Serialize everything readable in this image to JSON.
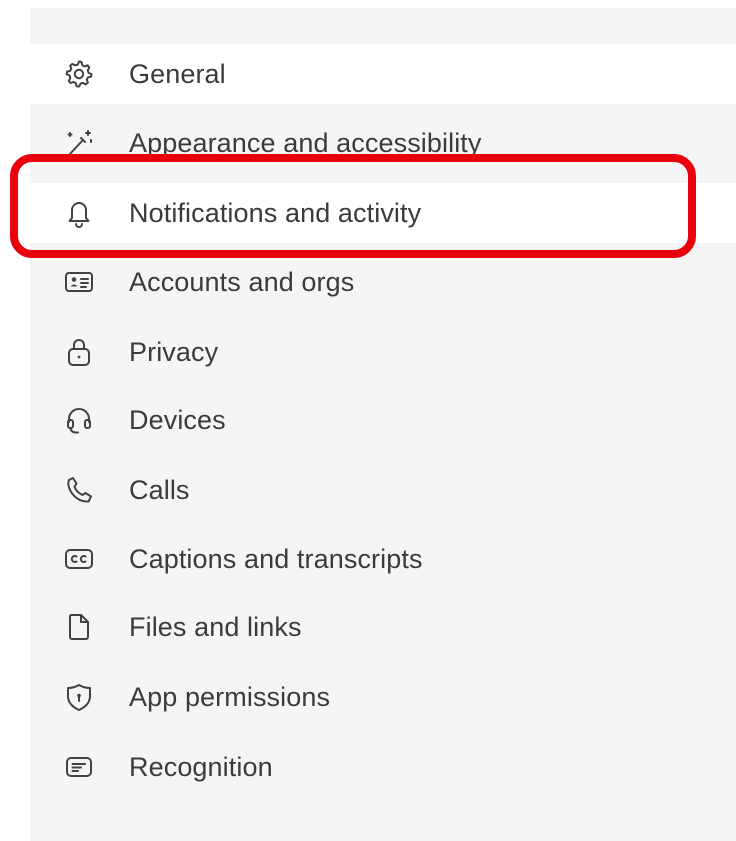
{
  "settings_menu": {
    "items": [
      {
        "label": "General",
        "icon": "gear-icon"
      },
      {
        "label": "Appearance and accessibility",
        "icon": "magic-wand-icon"
      },
      {
        "label": "Notifications and activity",
        "icon": "bell-icon"
      },
      {
        "label": "Accounts and orgs",
        "icon": "contact-card-icon"
      },
      {
        "label": "Privacy",
        "icon": "lock-icon"
      },
      {
        "label": "Devices",
        "icon": "headset-icon"
      },
      {
        "label": "Calls",
        "icon": "phone-icon"
      },
      {
        "label": "Captions and transcripts",
        "icon": "closed-captions-icon"
      },
      {
        "label": "Files and links",
        "icon": "document-icon"
      },
      {
        "label": "App permissions",
        "icon": "shield-icon"
      },
      {
        "label": "Recognition",
        "icon": "text-box-icon"
      }
    ],
    "highlighted_item": "Notifications and activity"
  },
  "colors": {
    "highlight_border": "#e8000b",
    "panel_background": "#f5f5f5",
    "row_active_background": "#ffffff",
    "text": "#3b3b3b",
    "icon": "#424242"
  }
}
